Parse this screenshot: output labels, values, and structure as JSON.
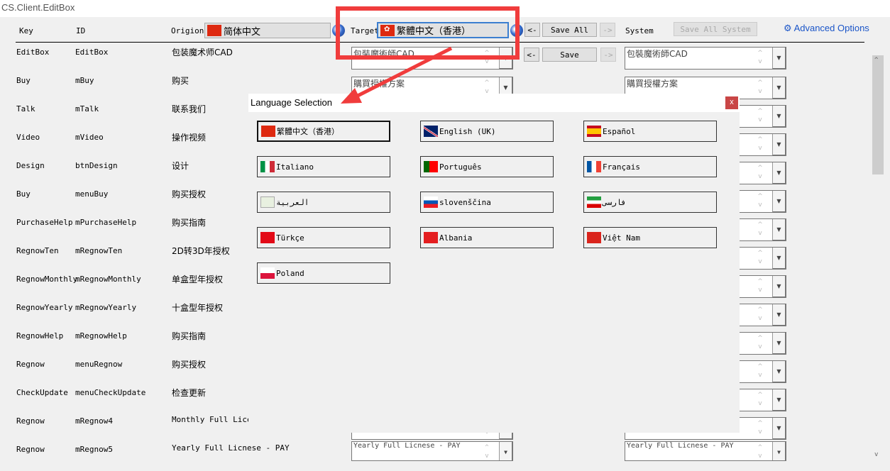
{
  "window": {
    "title": "CS.Client.EditBox"
  },
  "header": {
    "key": "Key",
    "id": "ID",
    "origin_label": "Origion",
    "origin_value": "简体中文",
    "target_label": "Target",
    "target_value": "繁體中文（香港）",
    "save_all": "Save All",
    "left_arrow": "<-",
    "right_arrow": "->",
    "system": "System",
    "save_all_system": "Save All System",
    "advanced": "Advanced Options"
  },
  "save_row": {
    "left": "<-",
    "save": "Save",
    "right": "->"
  },
  "rows": [
    {
      "key": "EditBox",
      "id": "EditBox",
      "origin": "包装魔术师CAD",
      "target": "包裝魔術師CAD",
      "system": "包裝魔術師CAD"
    },
    {
      "key": "Buy",
      "id": "mBuy",
      "origin": "购买",
      "target": "購買授權方案",
      "system": "購買授權方案"
    },
    {
      "key": "Talk",
      "id": "mTalk",
      "origin": "联系我们"
    },
    {
      "key": "Video",
      "id": "mVideo",
      "origin": "操作视频"
    },
    {
      "key": "Design",
      "id": "btnDesign",
      "origin": "设计"
    },
    {
      "key": "Buy",
      "id": "menuBuy",
      "origin": "购买授权"
    },
    {
      "key": "PurchaseHelp",
      "id": "mPurchaseHelp",
      "origin": "购买指南"
    },
    {
      "key": "RegnowTen",
      "id": "mRegnowTen",
      "origin": "2D转3D年授权"
    },
    {
      "key": "RegnowMonthly",
      "id": "mRegnowMonthly",
      "origin": "单盒型年授权"
    },
    {
      "key": "RegnowYearly",
      "id": "mRegnowYearly",
      "origin": "十盒型年授权"
    },
    {
      "key": "RegnowHelp",
      "id": "mRegnowHelp",
      "origin": "购买指南"
    },
    {
      "key": "Regnow",
      "id": "menuRegnow",
      "origin": "购买授权"
    },
    {
      "key": "CheckUpdate",
      "id": "menuCheckUpdate",
      "origin": "检查更新"
    },
    {
      "key": "Regnow",
      "id": "mRegnow4",
      "origin": "Monthly Full Licen"
    },
    {
      "key": "Regnow",
      "id": "mRegnow5",
      "origin": "Yearly Full Licnese - PAY",
      "target": "Yearly Full Licnese - PAY",
      "system": "Yearly Full Licnese - PAY"
    }
  ],
  "dialog": {
    "title": "Language Selection",
    "close": "x",
    "languages": [
      {
        "label": "繁體中文（香港）",
        "flag": "hk",
        "selected": true
      },
      {
        "label": "English (UK)",
        "flag": "uk"
      },
      {
        "label": "Español",
        "flag": "es"
      },
      {
        "label": "Italiano",
        "flag": "it"
      },
      {
        "label": "Português",
        "flag": "pt"
      },
      {
        "label": "Français",
        "flag": "fr"
      },
      {
        "label": "العربية",
        "flag": "arab"
      },
      {
        "label": "slovenščina",
        "flag": "si"
      },
      {
        "label": "فارسی",
        "flag": "ir"
      },
      {
        "label": "Türkçe",
        "flag": "tr"
      },
      {
        "label": "Albania",
        "flag": "al"
      },
      {
        "label": "Việt Nam",
        "flag": "vn"
      },
      {
        "label": "Poland",
        "flag": "pl"
      }
    ]
  },
  "colors": {
    "annotation": "#f03c3c",
    "accent": "#1a55c8",
    "close": "#c94646"
  }
}
